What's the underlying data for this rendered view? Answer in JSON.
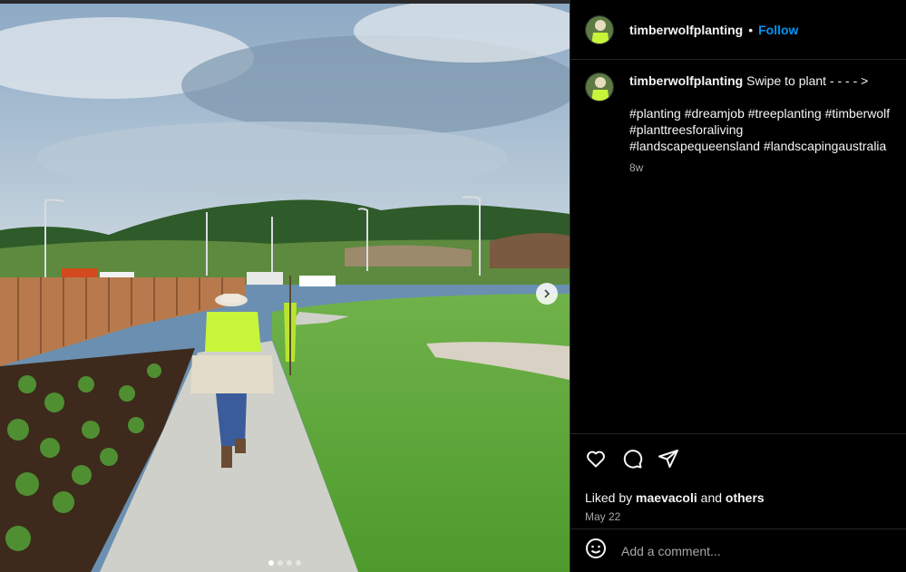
{
  "post": {
    "username": "timberwolfplanting",
    "separator": "•",
    "follow_label": "Follow",
    "caption_text": "Swipe to plant - - - - >",
    "hashtags_line1": "#planting #dreamjob #treeplanting #timberwolf",
    "hashtags_line2": "#planttreesforaliving",
    "hashtags_line3": "#landscapequeensland #landscapingaustralia",
    "caption_age": "8w"
  },
  "actions": {
    "like_icon": "heart-icon",
    "comment_icon": "comment-icon",
    "share_icon": "send-icon"
  },
  "likes": {
    "prefix": "Liked by",
    "user": "maevacoli",
    "connector": "and",
    "others": "others"
  },
  "date": "May 22",
  "comment_box": {
    "emoji_icon": "emoji-icon",
    "placeholder": "Add a comment..."
  },
  "carousel": {
    "next_icon": "chevron-right-icon",
    "slides": 4,
    "active_slide": 1
  },
  "colors": {
    "accent": "#0095f6",
    "background": "#000000",
    "muted": "#a8a8a8"
  }
}
